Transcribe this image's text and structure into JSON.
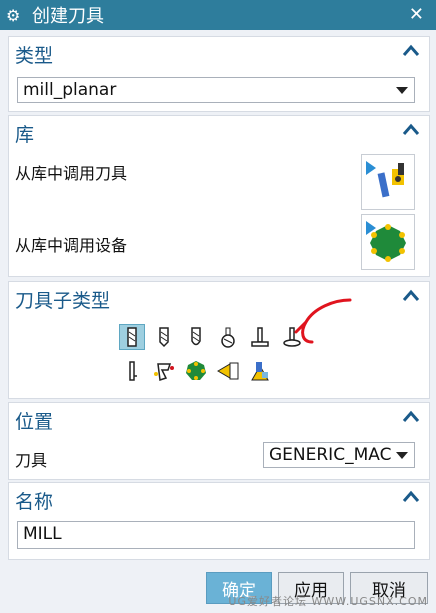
{
  "window": {
    "title": "创建刀具"
  },
  "sections": {
    "type": {
      "header": "类型",
      "value": "mill_planar"
    },
    "library": {
      "header": "库",
      "retrieve_tool": "从库中调用刀具",
      "retrieve_device": "从库中调用设备"
    },
    "subtype": {
      "header": "刀具子类型"
    },
    "location": {
      "header": "位置",
      "tool_label": "刀具",
      "tool_value": "GENERIC_MAC"
    },
    "name": {
      "header": "名称",
      "value": "MILL"
    }
  },
  "buttons": {
    "ok": "确定",
    "apply": "应用",
    "cancel": "取消"
  },
  "watermark": "UG爱好者论坛 WWW.UGSNX.COM",
  "colors": {
    "titlebar": "#2e7d9c",
    "header_text": "#1a5a8a",
    "annotation": "#e0141e"
  }
}
